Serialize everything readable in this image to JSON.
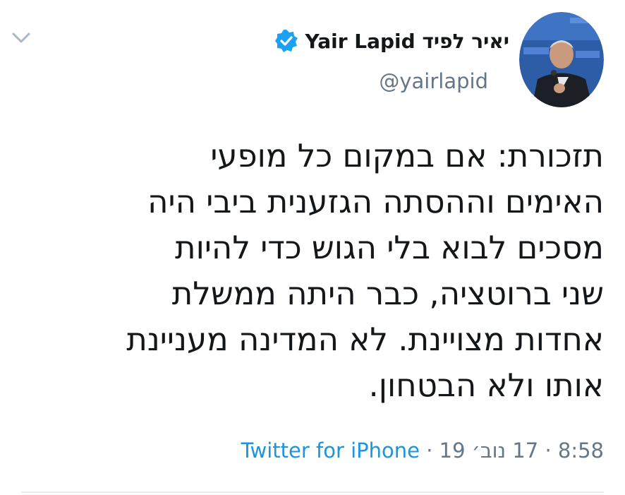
{
  "tweet": {
    "display_name": "יאיר לפיד Yair Lapid",
    "handle": "@yairlapid",
    "verified": true,
    "body_lines": [
      "תזכורת: אם במקום כל מופעי",
      "האימים וההסתה הגזענית ביבי היה",
      "מסכים לבוא בלי הגוש כדי להיות",
      "שני ברוטציה, כבר היתה ממשלת",
      "אחדות מצויינת. לא המדינה מעניינת",
      "אותו ולא הבטחון."
    ],
    "time": "8:58",
    "date": "17 נוב׳ 19",
    "separator": "·",
    "source": "Twitter for iPhone"
  },
  "icons": {
    "menu": "chevron-down-icon",
    "verified": "verified-badge-icon"
  },
  "colors": {
    "text_primary": "#14171a",
    "text_secondary": "#657786",
    "link": "#1b95e0",
    "verified": "#1da1f2",
    "divider": "#e6ecf0"
  }
}
